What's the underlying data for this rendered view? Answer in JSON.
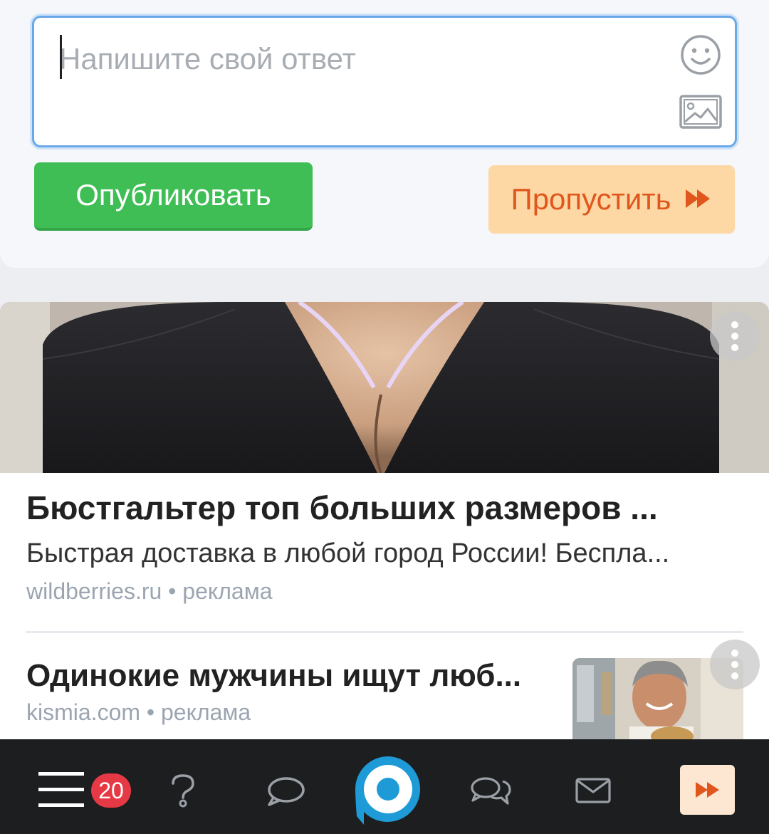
{
  "answer": {
    "placeholder": "Напишите свой ответ",
    "value": "",
    "emoji_icon": "smiley-icon",
    "image_icon": "image-icon"
  },
  "actions": {
    "publish_label": "Опубликовать",
    "skip_label": "Пропустить",
    "skip_icon": "fast-forward-icon"
  },
  "ads": [
    {
      "title": "Бюстгальтер топ больших размеров ...",
      "description": "Быстрая доставка в любой город России! Беспла...",
      "source": "wildberries.ru",
      "tag": "реклама",
      "separator": " • "
    },
    {
      "title": "Одинокие мужчины ищут люб...",
      "source": "kismia.com",
      "tag": "реклама",
      "separator": " • "
    }
  ],
  "nav": {
    "menu_icon": "hamburger-menu-icon",
    "badge_count": "20",
    "items": [
      "question-icon",
      "comment-icon",
      "center-logo-icon",
      "chat-bubbles-icon",
      "mail-icon",
      "fast-forward-icon"
    ]
  },
  "colors": {
    "publish": "#3fbe55",
    "skip_bg": "#fdd8a5",
    "skip_text": "#e0561c",
    "focus_border": "#6aa8e8",
    "badge": "#e63946",
    "nav_bg": "#1d1e20",
    "logo_blue": "#1e9bd7"
  }
}
